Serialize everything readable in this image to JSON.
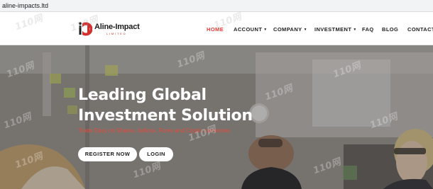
{
  "browser": {
    "url": "aline-impacts.ltd"
  },
  "brand": {
    "name": "Aline-Impact",
    "tagline": "LIMITED"
  },
  "nav": [
    {
      "label": "HOME",
      "active": true,
      "dropdown": false
    },
    {
      "label": "ACCOUNT",
      "active": false,
      "dropdown": true
    },
    {
      "label": "COMPANY",
      "active": false,
      "dropdown": true
    },
    {
      "label": "INVESTMENT",
      "active": false,
      "dropdown": true
    },
    {
      "label": "FAQ",
      "active": false,
      "dropdown": false
    },
    {
      "label": "BLOG",
      "active": false,
      "dropdown": false
    },
    {
      "label": "CONTACT",
      "active": false,
      "dropdown": false
    }
  ],
  "hero": {
    "title_line1": "Leading Global",
    "title_line2": "Investment Solution",
    "subtitle": "Trade Easy on Shares, Indices, Forex and Crypto currencies",
    "register_label": "REGISTER NOW",
    "login_label": "LOGIN"
  },
  "watermark": {
    "text": "110网"
  },
  "colors": {
    "accent": "#e53935",
    "subtitle": "#e84a3a",
    "nav_text": "#222222"
  }
}
